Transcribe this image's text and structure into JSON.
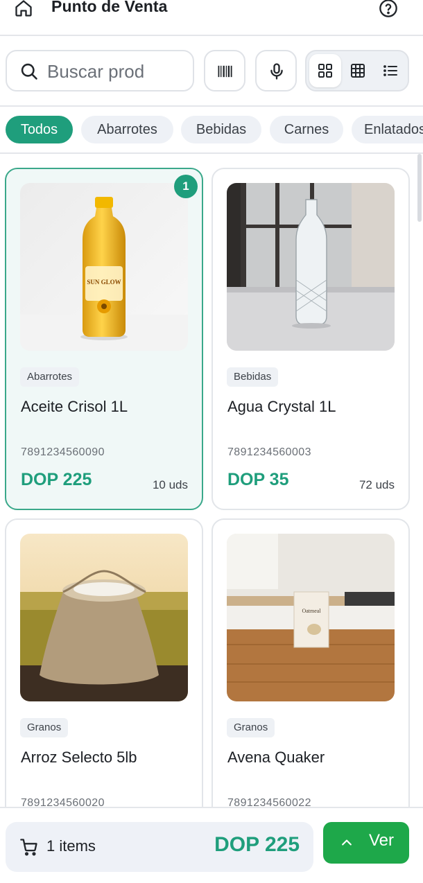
{
  "header": {
    "title": "Punto de Venta",
    "home_icon": "home-icon",
    "help_icon": "help-circle-icon"
  },
  "search": {
    "placeholder": "Buscar productos...",
    "value": "",
    "visible_text": "Buscar prod",
    "barcode_icon": "barcode-icon",
    "mic_icon": "microphone-icon"
  },
  "view_modes": [
    {
      "name": "grid-large",
      "icon": "grid-large-icon",
      "active": true
    },
    {
      "name": "grid-small",
      "icon": "grid-small-icon",
      "active": false
    },
    {
      "name": "list",
      "icon": "list-icon",
      "active": false
    }
  ],
  "categories": [
    {
      "label": "Todos",
      "active": true
    },
    {
      "label": "Abarrotes",
      "active": false
    },
    {
      "label": "Bebidas",
      "active": false
    },
    {
      "label": "Carnes",
      "active": false
    },
    {
      "label": "Enlatados",
      "active": false
    }
  ],
  "products": [
    {
      "category": "Abarrotes",
      "name": "Aceite Crisol 1L",
      "sku": "7891234560090",
      "price": "DOP 225",
      "stock": "10 uds",
      "selected": true,
      "qty_badge": "1",
      "image": "oil-bottle-photo",
      "label_text": "SUN GLOW"
    },
    {
      "category": "Bebidas",
      "name": "Agua Crystal 1L",
      "sku": "7891234560003",
      "price": "DOP 35",
      "stock": "72 uds",
      "selected": false,
      "image": "glass-water-bottle-photo"
    },
    {
      "category": "Granos",
      "name": "Arroz Selecto 5lb",
      "sku": "7891234560020",
      "price": "",
      "stock": "",
      "selected": false,
      "image": "rice-sack-photo"
    },
    {
      "category": "Granos",
      "name": "Avena Quaker",
      "sku": "7891234560022",
      "price": "",
      "stock": "",
      "selected": false,
      "image": "oatmeal-box-photo",
      "label_text": "Oatmeal"
    }
  ],
  "cart": {
    "items_label": "1 items",
    "total": "DOP 225",
    "cart_icon": "cart-icon",
    "view_button": "Ver",
    "view_icon": "chevron-up-icon"
  },
  "colors": {
    "accent": "#1f9e7c",
    "view_button": "#1ea84a",
    "selected_card_bg": "#f0f8f7"
  }
}
